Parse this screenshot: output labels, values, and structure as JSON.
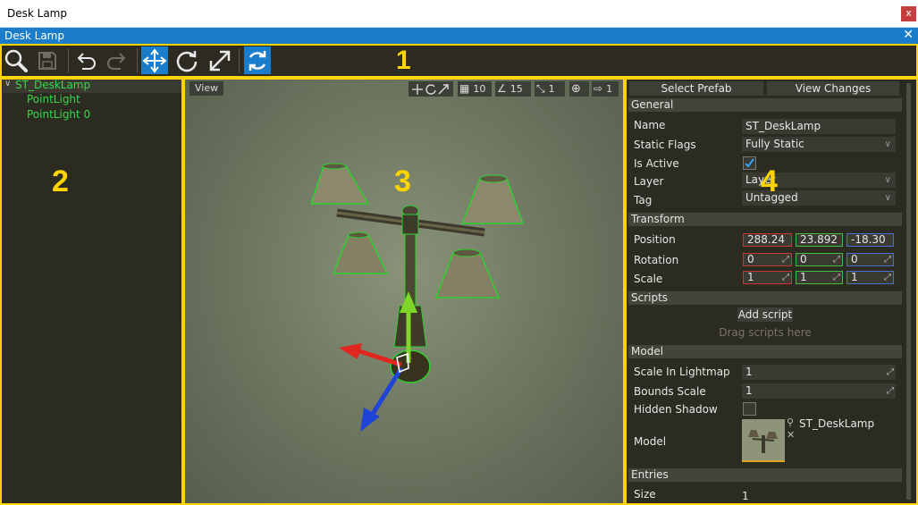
{
  "window": {
    "title": "Desk Lamp",
    "close_label": "x"
  },
  "dock": {
    "title": "Desk Lamp",
    "close_label": "✕"
  },
  "annotations": {
    "toolbar": "1",
    "tree": "2",
    "viewport": "3",
    "properties": "4"
  },
  "toolbar": {
    "buttons": [
      "search-icon",
      "save-icon",
      "undo-icon",
      "redo-icon",
      "translate-gizmo-icon",
      "rotate-gizmo-icon",
      "scale-gizmo-icon",
      "live-update-icon"
    ],
    "active": [
      "translate-gizmo-icon",
      "live-update-icon"
    ],
    "accent": "#1a7dcc"
  },
  "tree": {
    "root": "ST_DeskLamp",
    "children": [
      "PointLight",
      "PointLight 0"
    ],
    "text_color": "#37d84a"
  },
  "viewport": {
    "view_label": "View",
    "grid_snap": "10",
    "angle_snap": "15",
    "scale_snap": "1",
    "speed": "1"
  },
  "properties": {
    "select_prefab": "Select Prefab",
    "view_changes": "View Changes",
    "general": {
      "header": "General",
      "name_label": "Name",
      "name_value": "ST_DeskLamp",
      "static_flags_label": "Static Flags",
      "static_flags_value": "Fully Static",
      "is_active_label": "Is Active",
      "is_active": true,
      "layer_label": "Layer",
      "layer_value": "Layer",
      "tag_label": "Tag",
      "tag_value": "Untagged"
    },
    "transform": {
      "header": "Transform",
      "position_label": "Position",
      "position": [
        "288.24",
        "23.892",
        "-18.30"
      ],
      "rotation_label": "Rotation",
      "rotation": [
        "0",
        "0",
        "0"
      ],
      "scale_label": "Scale",
      "scale": [
        "1",
        "1",
        "1"
      ]
    },
    "scripts": {
      "header": "Scripts",
      "add_script": "Add script",
      "drag_hint": "Drag scripts here"
    },
    "model": {
      "header": "Model",
      "lightmap_label": "Scale In Lightmap",
      "lightmap_value": "1",
      "bounds_label": "Bounds Scale",
      "bounds_value": "1",
      "hidden_shadow_label": "Hidden Shadow",
      "hidden_shadow": false,
      "model_label": "Model",
      "model_asset": "ST_DeskLamp"
    },
    "entries": {
      "header": "Entries",
      "size_label": "Size",
      "size_value": "1"
    }
  }
}
